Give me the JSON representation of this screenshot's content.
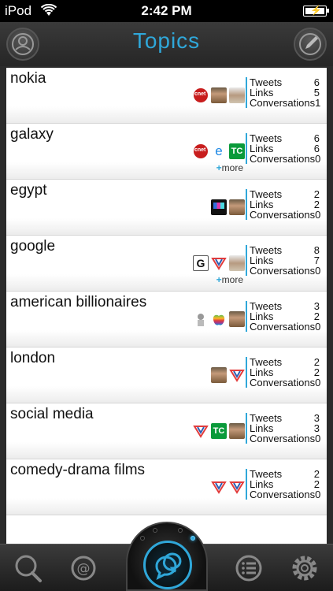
{
  "status_bar": {
    "carrier": "iPod",
    "time": "2:42 PM"
  },
  "nav": {
    "title": "Topics",
    "left_icon": "profile-icon",
    "right_icon": "compose-icon"
  },
  "colors": {
    "accent": "#2fa7d9",
    "background": "#2b2b2b",
    "list_bg": "#ffffff"
  },
  "stat_labels": {
    "tweets": "Tweets",
    "links": "Links",
    "conversations": "Conversations"
  },
  "more_label": "more",
  "more_prefix": "+",
  "topics": [
    {
      "name": "nokia",
      "sources": [
        "cnet",
        "face",
        "face2"
      ],
      "tweets": "6",
      "links": "5",
      "conversations": "1",
      "more": false
    },
    {
      "name": "galaxy",
      "sources": [
        "cnet",
        "engadget",
        "techcrunch"
      ],
      "tweets": "6",
      "links": "6",
      "conversations": "0",
      "more": true
    },
    {
      "name": "egypt",
      "sources": [
        "dark",
        "face"
      ],
      "tweets": "2",
      "links": "2",
      "conversations": "0",
      "more": false
    },
    {
      "name": "google",
      "sources": [
        "g",
        "v",
        "face2"
      ],
      "tweets": "8",
      "links": "7",
      "conversations": "0",
      "more": true
    },
    {
      "name": "american billionaires",
      "sources": [
        "mac",
        "apple",
        "face"
      ],
      "tweets": "3",
      "links": "2",
      "conversations": "0",
      "more": false
    },
    {
      "name": "london",
      "sources": [
        "face",
        "v"
      ],
      "tweets": "2",
      "links": "2",
      "conversations": "0",
      "more": false
    },
    {
      "name": "social media",
      "sources": [
        "v",
        "techcrunch",
        "face"
      ],
      "tweets": "3",
      "links": "3",
      "conversations": "0",
      "more": false
    },
    {
      "name": "comedy-drama films",
      "sources": [
        "v",
        "turn"
      ],
      "tweets": "2",
      "links": "2",
      "conversations": "0",
      "more": false
    }
  ],
  "tabbar": {
    "tabs": [
      {
        "name": "search-icon"
      },
      {
        "name": "mentions-icon"
      },
      {
        "name": "conversations-icon"
      },
      {
        "name": "list-icon"
      },
      {
        "name": "settings-icon"
      }
    ]
  }
}
